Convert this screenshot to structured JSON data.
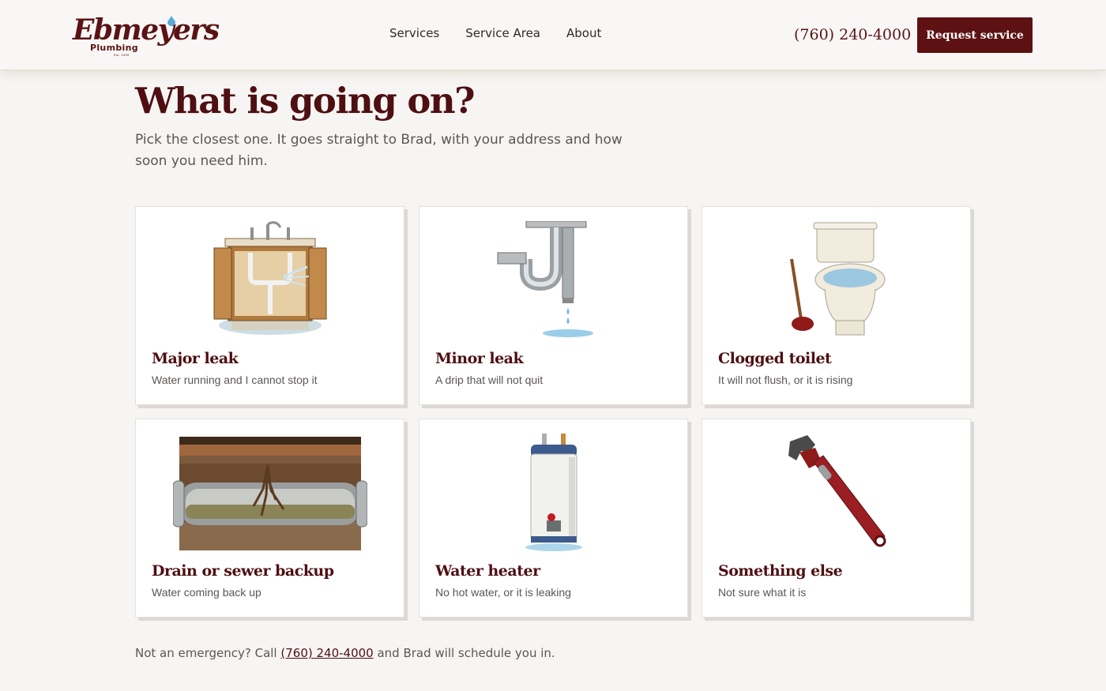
{
  "brand": {
    "name": "Ebmeyers",
    "sub": "Plumbing",
    "est": "Est. 1999"
  },
  "nav": {
    "items": [
      {
        "label": "Services"
      },
      {
        "label": "Service Area"
      },
      {
        "label": "About"
      }
    ]
  },
  "header": {
    "phone": "(760) 240-4000",
    "cta_label": "Request service"
  },
  "hero": {
    "title": "What is going on?",
    "subtitle": "Pick the closest one. It goes straight to Brad, with your address and how soon you need him."
  },
  "cards": [
    {
      "title": "Major leak",
      "desc": "Water running and I cannot stop it",
      "icon": "leaking-sink-cabinet-icon"
    },
    {
      "title": "Minor leak",
      "desc": "A drip that will not quit",
      "icon": "dripping-pipe-icon"
    },
    {
      "title": "Clogged toilet",
      "desc": "It will not flush, or it is rising",
      "icon": "toilet-plunger-icon"
    },
    {
      "title": "Drain or sewer backup",
      "desc": "Water coming back up",
      "icon": "sewer-pipe-roots-icon"
    },
    {
      "title": "Water heater",
      "desc": "No hot water, or it is leaking",
      "icon": "water-heater-icon"
    },
    {
      "title": "Something else",
      "desc": "Not sure what it is",
      "icon": "pipe-wrench-icon"
    }
  ],
  "footer_note": {
    "prefix": "Not an emergency? Call ",
    "phone": "(760) 240-4000",
    "suffix": " and Brad will schedule you in."
  },
  "colors": {
    "brand": "#5d1113",
    "heading": "#4e0f12",
    "background": "#f7f5f4",
    "card": "#ffffff"
  }
}
